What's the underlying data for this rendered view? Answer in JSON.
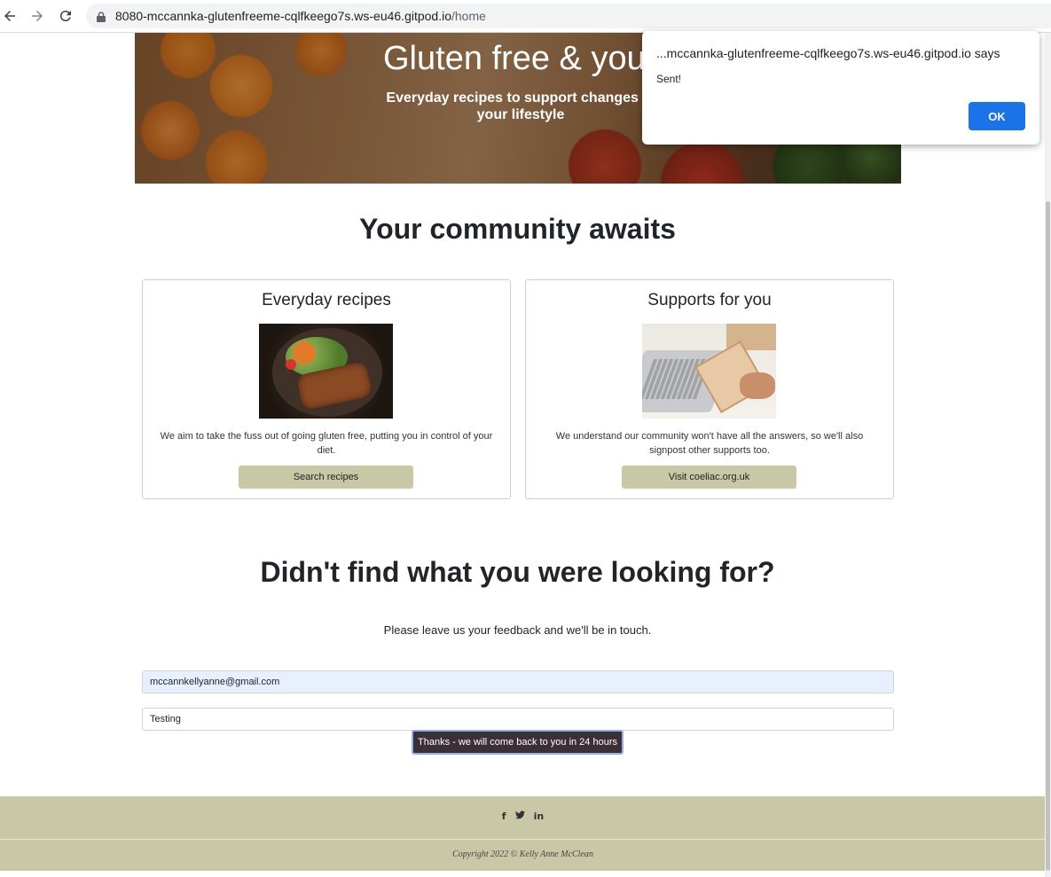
{
  "browser": {
    "url_host": "8080-mccannka-glutenfreeme-cqlfkeego7s.ws-eu46.gitpod.io",
    "url_path": "/home"
  },
  "hero": {
    "title": "Gluten free & you",
    "subtitle": "Everyday recipes to support changes in your lifestyle"
  },
  "community": {
    "heading": "Your community awaits",
    "cards": [
      {
        "title": "Everyday recipes",
        "text": "We aim to take the fuss out of going gluten free, putting you in control of your diet.",
        "button": "Search recipes"
      },
      {
        "title": "Supports for you",
        "text": "We understand our community won't have all the answers, so we'll also signpost other supports too.",
        "button": "Visit coeliac.org.uk"
      }
    ]
  },
  "feedback": {
    "heading": "Didn't find what you were looking for?",
    "subtext": "Please leave us your feedback and we'll be in touch.",
    "email_value": "mccannkellyanne@gmail.com",
    "message_value": "Testing",
    "submit_label": "Thanks - we will come back to you in 24 hours"
  },
  "footer": {
    "social": [
      "f",
      "t",
      "in"
    ],
    "copyright": "Copyright 2022 © Kelly Anne McClean"
  },
  "dialog": {
    "title": "...mccannka-glutenfreeme-cqlfkeego7s.ws-eu46.gitpod.io says",
    "message": "Sent!",
    "ok_label": "OK"
  },
  "colors": {
    "accent_button": "#c9c8a6",
    "submit_button": "#3b3036",
    "dialog_ok": "#1a73e8"
  }
}
